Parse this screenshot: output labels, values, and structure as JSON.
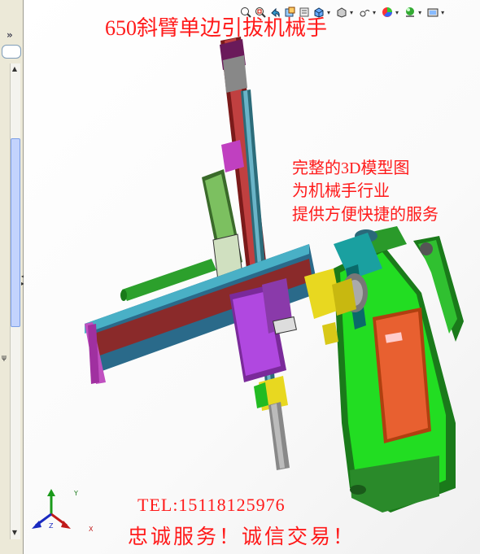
{
  "side_panel": {
    "expand_glyph": "»",
    "side_glyph": "ψ"
  },
  "toolbar": {
    "icons": [
      "zoom-to-fit-icon",
      "zoom-area-icon",
      "previous-view-icon",
      "section-view-icon",
      "dynamic-annotation-icon",
      "view-orientation-icon",
      "display-style-icon",
      "hide-show-items-icon",
      "edit-appearance-icon",
      "apply-scene-icon",
      "view-settings-icon"
    ]
  },
  "overlay": {
    "title": "650斜臂单边引拔机械手",
    "desc_line1": "完整的3D模型图",
    "desc_line2": "为机械手行业",
    "desc_line3": "提供方便快捷的服务",
    "tel": "TEL:15118125976",
    "slogan": "忠诚服务！诚信交易！"
  },
  "triad": {
    "x": "X",
    "y": "Y",
    "z": "Z"
  },
  "colors": {
    "overlay_text": "#ff1a1a",
    "green_part": "#22dd22",
    "purple_part": "#b040e0",
    "teal_part": "#1aa0a0"
  }
}
